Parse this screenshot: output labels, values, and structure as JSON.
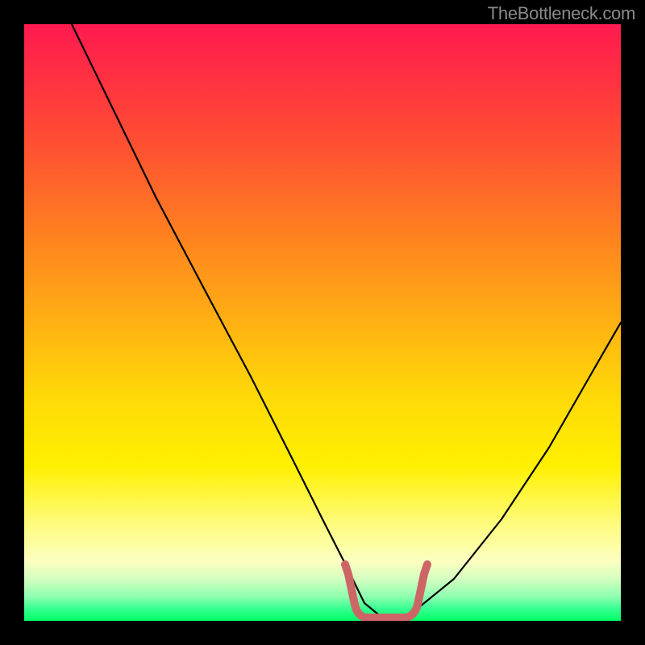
{
  "watermark": "TheBottleneck.com",
  "colors": {
    "frame_bg": "#000000",
    "gradient_top": "#ff1a50",
    "gradient_mid": "#fff000",
    "gradient_bottom": "#00ff66",
    "curve_stroke": "#000000",
    "marker_stroke": "#cc6666"
  },
  "chart_data": {
    "type": "line",
    "title": "",
    "xlabel": "",
    "ylabel": "",
    "xlim": [
      0,
      100
    ],
    "ylim": [
      0,
      100
    ],
    "series": [
      {
        "name": "bottleneck-curve",
        "x": [
          8,
          15,
          22,
          30,
          38,
          45,
          50,
          54,
          57,
          60,
          64,
          72,
          80,
          88,
          96,
          100
        ],
        "values": [
          100,
          85.5,
          71,
          56,
          41,
          27,
          17,
          9,
          3,
          0.5,
          0.5,
          7,
          17,
          29,
          43,
          50
        ]
      }
    ],
    "annotations": [
      {
        "name": "flat-bottom-marker",
        "x_start": 54,
        "x_end": 64,
        "y": 0.5
      }
    ]
  }
}
